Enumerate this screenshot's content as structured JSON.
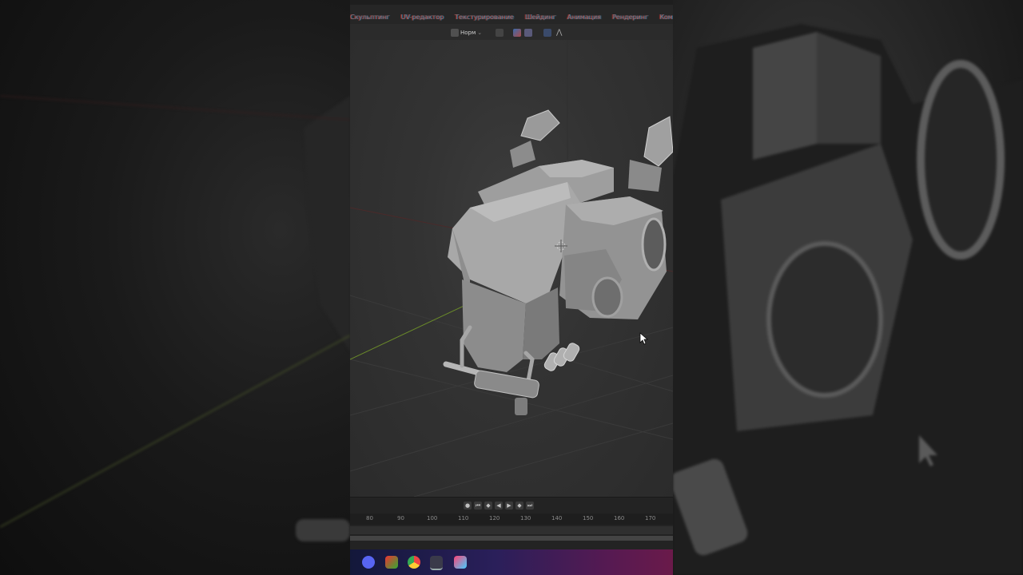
{
  "app": {
    "name": "Blender"
  },
  "workspace_tabs": [
    "Скульптинг",
    "UV-редактор",
    "Текстурирование",
    "Шейдинг",
    "Анимация",
    "Рендеринг",
    "Композитинг"
  ],
  "viewport_header": {
    "shading_mode": "Норм"
  },
  "timeline": {
    "frame_ticks": [
      "80",
      "90",
      "100",
      "110",
      "120",
      "130",
      "140",
      "150",
      "160",
      "170"
    ]
  },
  "taskbar_apps": [
    "discord-icon",
    "pinterest-icon",
    "chrome-icon",
    "blender-icon",
    "photoshop-icon"
  ],
  "colors": {
    "x_axis": "#8a3a3a",
    "y_axis": "#7a9a3a",
    "taskbar_start": "#13183a",
    "taskbar_end": "#6a1a4a"
  }
}
